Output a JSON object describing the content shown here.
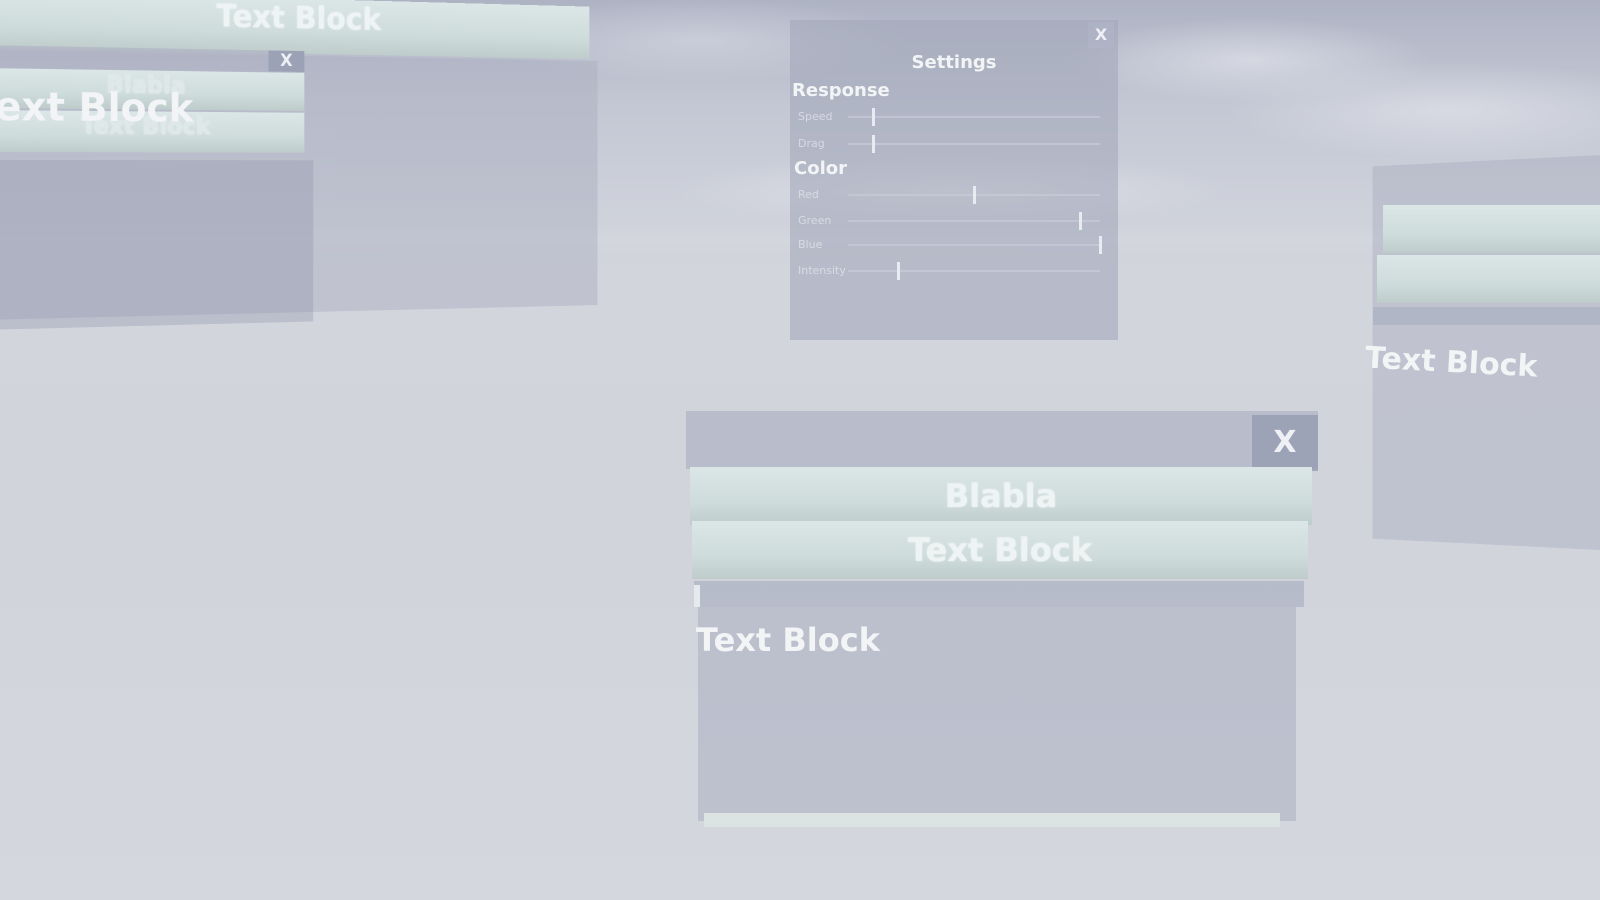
{
  "background": {
    "sky": "#c4c8d4",
    "ground": "#d3d5dd"
  },
  "left_panel": {
    "top_button": "Text Block",
    "close_label": "X",
    "inner_button1": "Blabla",
    "inner_text_large": "ext Block",
    "inner_button2": "Text Block"
  },
  "settings_panel": {
    "close_label": "X",
    "title": "Settings",
    "sections": [
      {
        "label": "Response",
        "sliders": [
          {
            "label": "Speed",
            "value": 0.1
          },
          {
            "label": "Drag",
            "value": 0.1
          }
        ]
      },
      {
        "label": "Color",
        "sliders": [
          {
            "label": "Red",
            "value": 0.5
          },
          {
            "label": "Green",
            "value": 0.92
          },
          {
            "label": "Blue",
            "value": 1.0
          },
          {
            "label": "Intensity",
            "value": 0.2
          }
        ]
      }
    ]
  },
  "main_panel": {
    "close_label": "X",
    "button1": "Blabla",
    "button2": "Text Block",
    "scroll_value": 0.0,
    "body_text": "Text Block"
  },
  "right_panel": {
    "body_text": "Text Block"
  }
}
